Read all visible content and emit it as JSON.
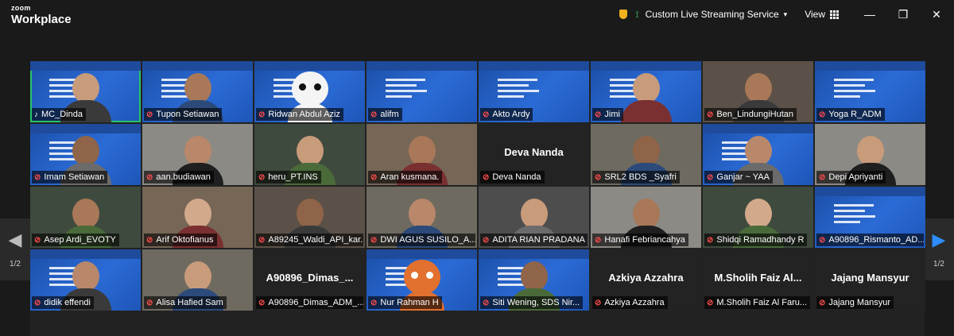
{
  "app": {
    "logo_line1": "zoom",
    "logo_line2": "Workplace"
  },
  "topbar": {
    "streaming_label": "Custom Live Streaming Service",
    "view_label": "View",
    "icons": [
      "shield-icon",
      "signal-icon",
      "chevron-down-icon",
      "grid-icon",
      "minimize-icon",
      "restore-icon",
      "close-icon"
    ]
  },
  "pager": {
    "left": "1/2",
    "right": "1/2",
    "accent": "#2d8cff"
  },
  "colors": {
    "active_speaker": "#29c46a",
    "muted": "#ff4b4b",
    "slide_blue": "#2b6bd6"
  },
  "participants": [
    {
      "name": "MC_Dinda",
      "muted": false,
      "active": true,
      "video": "person-slide",
      "name_only": ""
    },
    {
      "name": "Tupon Setiawan",
      "muted": true,
      "video": "person-slide",
      "name_only": ""
    },
    {
      "name": "Ridwan Abdul Aziz",
      "muted": true,
      "video": "panda-slide",
      "name_only": ""
    },
    {
      "name": "alifm",
      "muted": true,
      "video": "slide",
      "name_only": ""
    },
    {
      "name": "Akto Ardy",
      "muted": true,
      "video": "slide",
      "name_only": ""
    },
    {
      "name": "Jimi",
      "muted": true,
      "video": "person-slide",
      "name_only": ""
    },
    {
      "name": "Ben_LindungiHutan",
      "muted": true,
      "video": "person",
      "name_only": ""
    },
    {
      "name": "Yoga R_ADM",
      "muted": true,
      "video": "slide",
      "name_only": ""
    },
    {
      "name": "Imam Setiawan",
      "muted": true,
      "video": "person-slide",
      "name_only": ""
    },
    {
      "name": "aan.budiawan",
      "muted": true,
      "video": "person",
      "name_only": ""
    },
    {
      "name": "heru_PT.INS",
      "muted": true,
      "video": "person",
      "name_only": ""
    },
    {
      "name": "Aran kusmana.",
      "muted": true,
      "video": "person",
      "name_only": ""
    },
    {
      "name": "Deva Nanda",
      "muted": true,
      "video": "none",
      "name_only": "Deva Nanda"
    },
    {
      "name": "SRL2 BDS _Syafri",
      "muted": true,
      "video": "person",
      "name_only": ""
    },
    {
      "name": "Ganjar ~ YAA",
      "muted": true,
      "video": "person-slide",
      "name_only": ""
    },
    {
      "name": "Depi Apriyanti",
      "muted": true,
      "video": "person",
      "name_only": ""
    },
    {
      "name": "Asep Ardi_EVOTY",
      "muted": true,
      "video": "person",
      "name_only": ""
    },
    {
      "name": "Arif Oktofianus",
      "muted": true,
      "video": "person",
      "name_only": ""
    },
    {
      "name": "A89245_Waldi_API_kar...",
      "muted": true,
      "video": "person",
      "name_only": ""
    },
    {
      "name": "DWI AGUS SUSILO_A...",
      "muted": true,
      "video": "person",
      "name_only": ""
    },
    {
      "name": "ADITA RIAN PRADANA",
      "muted": true,
      "video": "person",
      "name_only": ""
    },
    {
      "name": "Hanafi Febriancahya",
      "muted": true,
      "video": "person",
      "name_only": ""
    },
    {
      "name": "Shidqi Ramadhandy R",
      "muted": true,
      "video": "person",
      "name_only": ""
    },
    {
      "name": "A90896_Rismanto_AD...",
      "muted": true,
      "video": "slide",
      "name_only": ""
    },
    {
      "name": "didik effendi",
      "muted": true,
      "video": "person-slide",
      "name_only": ""
    },
    {
      "name": "Alisa Hafied Sam",
      "muted": true,
      "video": "person",
      "name_only": ""
    },
    {
      "name": "A90896_Dimas_ADM_...",
      "muted": true,
      "video": "none",
      "name_only": "A90896_Dimas_..."
    },
    {
      "name": "Nur Rahman H",
      "muted": true,
      "video": "fox-slide",
      "name_only": ""
    },
    {
      "name": "Siti Wening, SDS Nir...",
      "muted": true,
      "video": "person-slide",
      "name_only": ""
    },
    {
      "name": "Azkiya Azzahra",
      "muted": true,
      "video": "none",
      "name_only": "Azkiya Azzahra"
    },
    {
      "name": "M.Sholih Faiz Al Faru...",
      "muted": true,
      "video": "none",
      "name_only": "M.Sholih Faiz Al..."
    },
    {
      "name": "Jajang Mansyur",
      "muted": true,
      "video": "none",
      "name_only": "Jajang Mansyur"
    }
  ]
}
